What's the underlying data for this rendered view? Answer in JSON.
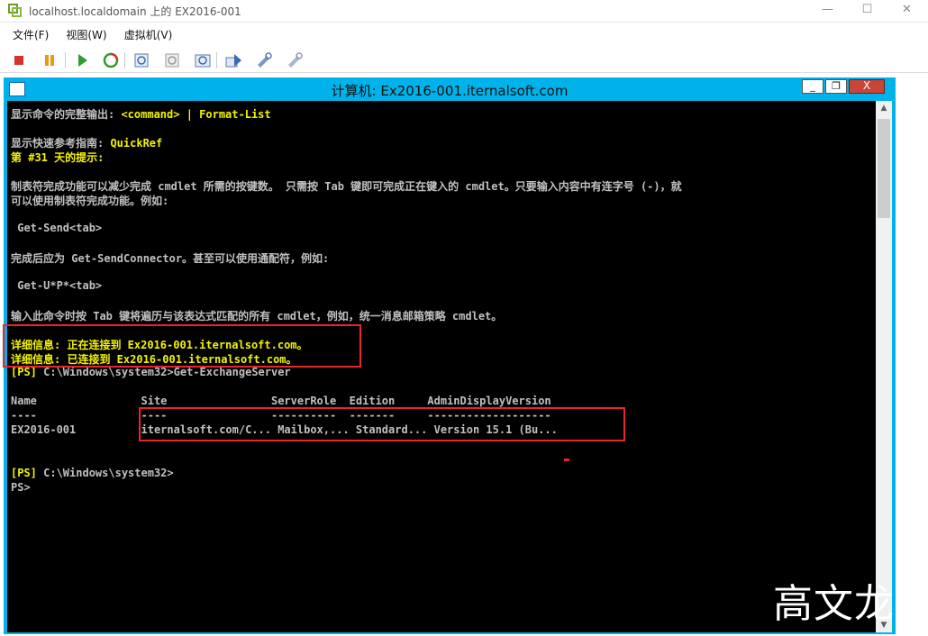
{
  "window": {
    "title": "localhost.localdomain 上的 EX2016-001",
    "minimize_glyph": "—",
    "maximize_glyph": "☐",
    "close_glyph": "✕"
  },
  "menubar": [
    "文件(F)",
    "视图(W)",
    "虚拟机(V)"
  ],
  "toolbar_icons": [
    "stop-icon",
    "pause-icon",
    "play-icon",
    "reset-icon",
    "snapshot-icon",
    "revert-icon",
    "manage-snapshots-icon",
    "send-keys-icon",
    "settings-icon",
    "tools-icon"
  ],
  "console_window": {
    "title": "计算机: Ex2016-001.iternalsoft.com",
    "minimize_glyph": "_",
    "restore_glyph": "❐",
    "close_glyph": "X"
  },
  "console": {
    "line1_label": "显示命令的完整输出: ",
    "line1_cmd": "<command> | Format-List",
    "line2_label": "显示快速参考指南: ",
    "line2_cmd": "QuickRef",
    "line3": "第 #31 天的提示:",
    "line4": "制表符完成功能可以减少完成 cmdlet 所需的按键数。 只需按 Tab 键即可完成正在键入的 cmdlet。只要输入内容中有连字号 (-)，就",
    "line5": "可以使用制表符完成功能。例如:",
    "line6": " Get-Send<tab>",
    "line7": "完成后应为 Get-SendConnector。甚至可以使用通配符，例如:",
    "line8": " Get-U*P*<tab>",
    "line9": "输入此命令时按 Tab 键将遍历与该表达式匹配的所有 cmdlet，例如，统一消息邮箱策略 cmdlet。",
    "line10": "详细信息: 正在连接到 Ex2016-001.iternalsoft.com。",
    "line11": "详细信息: 已连接到 Ex2016-001.iternalsoft.com。",
    "line12_prompt": "[PS] ",
    "line12_cmd": "C:\\Windows\\system32>Get-ExchangeServer",
    "table_header": "Name                Site                ServerRole  Edition     AdminDisplayVersion",
    "table_sep": "----                ----                ----------  -------     -------------------",
    "table_row": "EX2016-001          iternalsoft.com/C... Mailbox,... Standard... Version 15.1 (Bu...",
    "line16_prompt": "[PS] ",
    "line16_cmd": "C:\\Windows\\system32>",
    "line17": "PS>"
  },
  "watermark": "高文龙"
}
